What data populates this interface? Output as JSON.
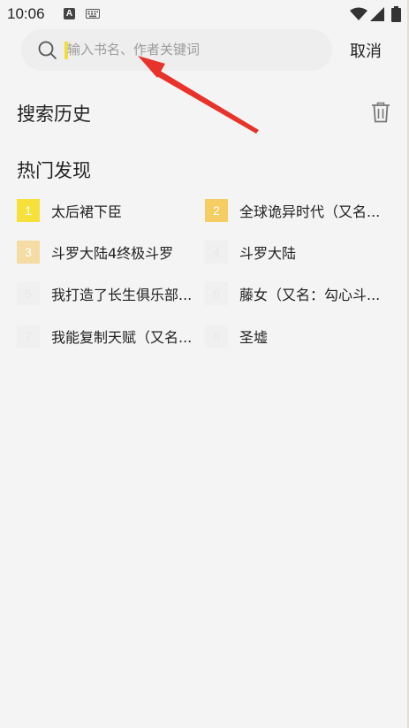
{
  "status_bar": {
    "time": "10:06",
    "notification_icon_letter": "A",
    "icons": [
      "keyboard-icon",
      "wifi-icon",
      "signal-icon",
      "battery-icon"
    ]
  },
  "search": {
    "placeholder": "输入书名、作者关键词",
    "value": "",
    "cancel_label": "取消"
  },
  "history": {
    "title": "搜索历史",
    "delete_icon": "trash-icon"
  },
  "hot": {
    "title": "热门发现",
    "items": [
      {
        "rank": "1",
        "title": "太后裙下臣",
        "badge_color": "#f7e03a"
      },
      {
        "rank": "2",
        "title": "全球诡异时代（又名...",
        "badge_color": "#f5cd62"
      },
      {
        "rank": "3",
        "title": "斗罗大陆4终极斗罗",
        "badge_color": "#f4dca3"
      },
      {
        "rank": "4",
        "title": "斗罗大陆",
        "badge_color": ""
      },
      {
        "rank": "5",
        "title": "我打造了长生俱乐部...",
        "badge_color": ""
      },
      {
        "rank": "6",
        "title": "藤女（又名：勾心斗...",
        "badge_color": ""
      },
      {
        "rank": "7",
        "title": "我能复制天赋（又名...",
        "badge_color": ""
      },
      {
        "rank": "8",
        "title": "圣墟",
        "badge_color": ""
      }
    ]
  },
  "colors": {
    "background": "#f5f4f4",
    "search_bg": "#efeeee",
    "cursor": "#f2dd3c",
    "arrow": "#e8322c"
  }
}
